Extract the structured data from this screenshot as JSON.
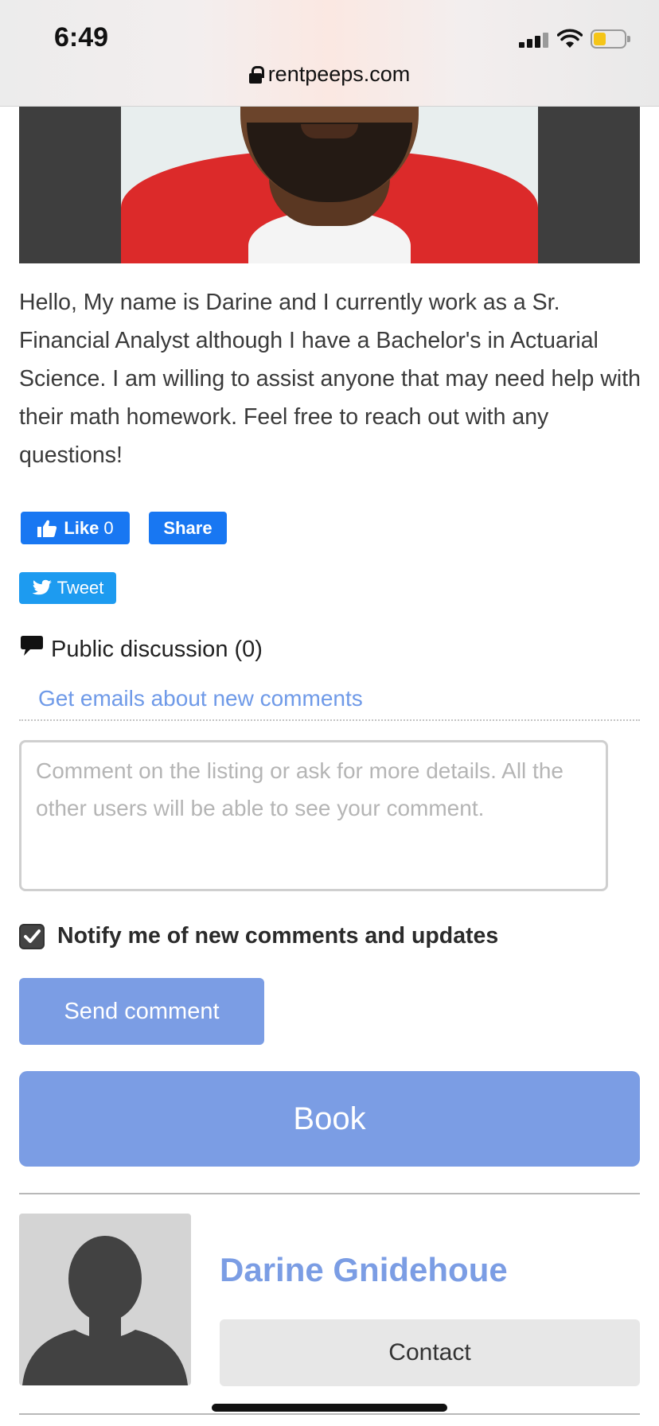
{
  "status_bar": {
    "time": "6:49",
    "url": "rentpeeps.com",
    "battery_level": 0.3,
    "icons": [
      "signal-icon",
      "wifi-icon",
      "battery-icon",
      "lock-icon"
    ]
  },
  "listing": {
    "description": "Hello, My name is Darine and I currently work as a Sr. Financial Analyst although I have a Bachelor's in Actuarial Science. I am willing to assist anyone that may need help with their math homework. Feel free to reach out with any questions!"
  },
  "social": {
    "like_label": "Like",
    "like_count": "0",
    "share_label": "Share",
    "tweet_label": "Tweet"
  },
  "discussion": {
    "title": "Public discussion (0)",
    "emails_link": "Get emails about new comments",
    "comment_placeholder": "Comment on the listing or ask for more details. All the other users will be able to see your comment.",
    "notify_label": "Notify me of new comments and updates",
    "notify_checked": true,
    "send_label": "Send comment"
  },
  "book_label": "Book",
  "owner": {
    "name": "Darine Gnidehoue",
    "contact_label": "Contact"
  },
  "colors": {
    "accent": "#7b9de4",
    "facebook": "#1877f2",
    "twitter": "#1d9bf0"
  }
}
